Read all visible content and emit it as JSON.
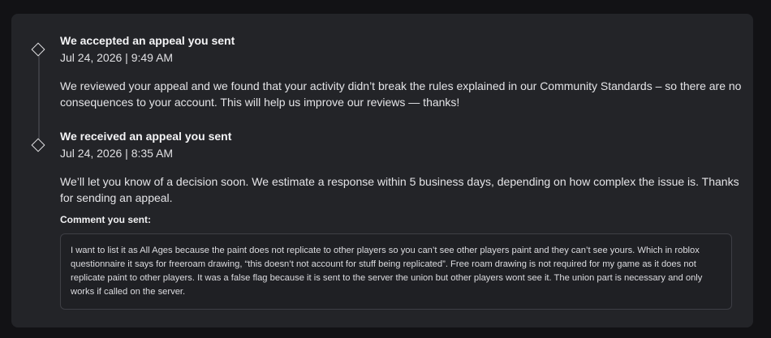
{
  "timeline": {
    "events": [
      {
        "title": "We accepted an appeal you sent",
        "timestamp": "Jul 24, 2026 | 9:49 AM",
        "body": "We reviewed your appeal and we found that your activity didn’t break the rules explained in our Community Standards – so there are no consequences to your account. This will help us improve our reviews — thanks!"
      },
      {
        "title": "We received an appeal you sent",
        "timestamp": "Jul 24, 2026 | 8:35 AM",
        "body": "We’ll let you know of a decision soon. We estimate a response within 5 business days, depending on how complex the issue is. Thanks for sending an appeal.",
        "comment_label": "Comment you sent:",
        "comment": "I want to list it as All Ages because the paint does not replicate to other players so you can’t see other players paint and they can’t see yours. Which in roblox questionnaire it says for freeroam drawing, “this doesn’t not account for stuff being replicated”. Free roam drawing is not required for my game as it does not replicate paint to other players. It was a false flag because it is sent to the server the union but other players wont see it. The union part is necessary and only works if called on the server."
      }
    ]
  }
}
